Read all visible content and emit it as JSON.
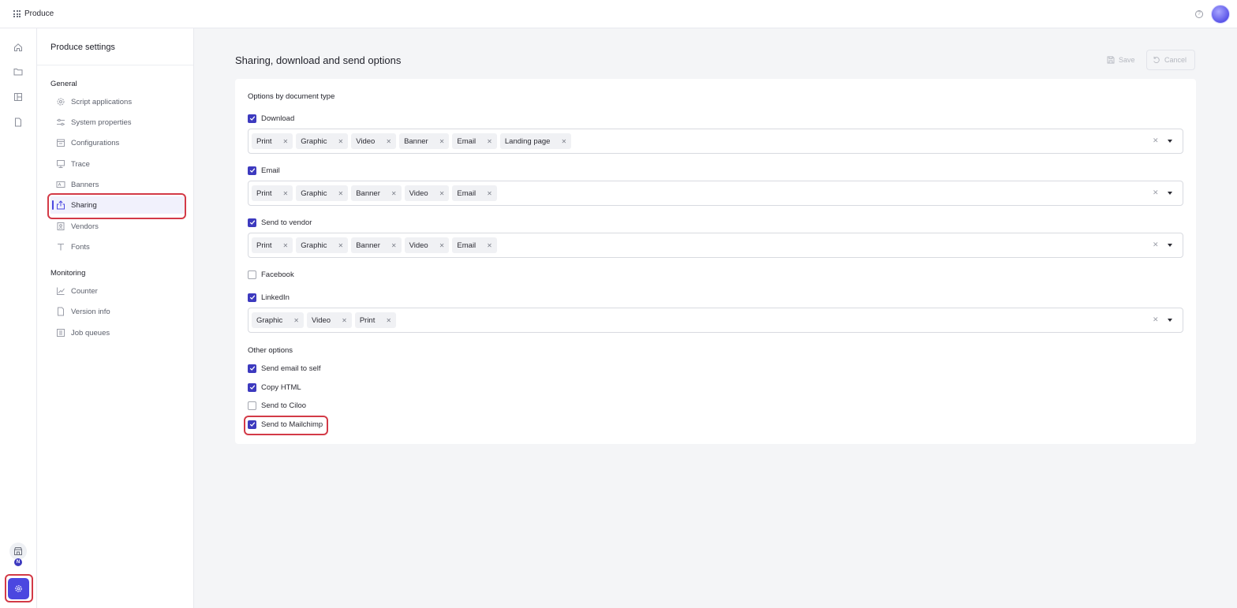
{
  "topbar": {
    "app_title": "Produce",
    "apps_icon": "grid-icon",
    "help_icon": "help-icon"
  },
  "rail": {
    "items": [
      "home-icon",
      "folder-icon",
      "layout-icon",
      "document-icon"
    ],
    "store_badge": "N",
    "settings_icon": "gear-icon"
  },
  "settings_nav": {
    "title": "Produce settings",
    "groups": [
      {
        "label": "General",
        "items": [
          {
            "label": "Script applications",
            "icon": "gear-icon"
          },
          {
            "label": "System properties",
            "icon": "sliders-icon"
          },
          {
            "label": "Configurations",
            "icon": "config-icon"
          },
          {
            "label": "Trace",
            "icon": "trace-icon"
          },
          {
            "label": "Banners",
            "icon": "banner-icon"
          },
          {
            "label": "Sharing",
            "icon": "share-icon",
            "active": true
          },
          {
            "label": "Vendors",
            "icon": "vendor-icon"
          },
          {
            "label": "Fonts",
            "icon": "font-icon"
          }
        ]
      },
      {
        "label": "Monitoring",
        "items": [
          {
            "label": "Counter",
            "icon": "chart-icon"
          },
          {
            "label": "Version info",
            "icon": "file-icon"
          },
          {
            "label": "Job queues",
            "icon": "queue-icon"
          }
        ]
      }
    ]
  },
  "main": {
    "title": "Sharing, download and send options",
    "save_label": "Save",
    "cancel_label": "Cancel"
  },
  "options": {
    "section_title": "Options by document type",
    "document_types": [
      {
        "label": "Download",
        "checked": true,
        "tags": [
          "Print",
          "Graphic",
          "Video",
          "Banner",
          "Email",
          "Landing page"
        ]
      },
      {
        "label": "Email",
        "checked": true,
        "tags": [
          "Print",
          "Graphic",
          "Banner",
          "Video",
          "Email"
        ]
      },
      {
        "label": "Send to vendor",
        "checked": true,
        "tags": [
          "Print",
          "Graphic",
          "Banner",
          "Video",
          "Email"
        ]
      },
      {
        "label": "Facebook",
        "checked": false,
        "tags": []
      },
      {
        "label": "LinkedIn",
        "checked": true,
        "tags": [
          "Graphic",
          "Video",
          "Print"
        ]
      }
    ],
    "other_title": "Other options",
    "other": [
      {
        "label": "Send email to self",
        "checked": true
      },
      {
        "label": "Copy HTML",
        "checked": true
      },
      {
        "label": "Send to Ciloo",
        "checked": false
      },
      {
        "label": "Send to Mailchimp",
        "checked": true
      }
    ]
  },
  "colors": {
    "accent": "#4b47e0",
    "checkbox": "#3d3abf",
    "highlight": "#d33a47"
  }
}
